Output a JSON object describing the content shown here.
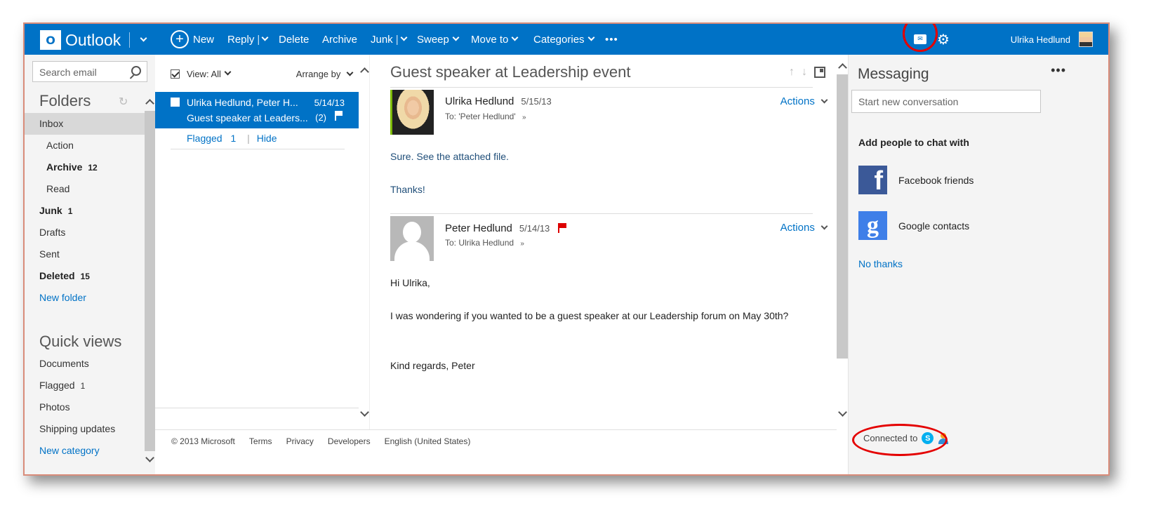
{
  "app": {
    "logo_letter": "O",
    "name": "Outlook"
  },
  "toolbar": {
    "new_label": "New",
    "reply_label": "Reply",
    "delete_label": "Delete",
    "archive_label": "Archive",
    "junk_label": "Junk",
    "sweep_label": "Sweep",
    "moveto_label": "Move to",
    "categories_label": "Categories",
    "more_label": "•••",
    "chat_icon": "chat-icon",
    "settings_icon": "gear-icon",
    "user_name": "Ulrika Hedlund"
  },
  "left": {
    "search_placeholder": "Search email",
    "folders_title": "Folders",
    "folders": [
      {
        "label": "Inbox",
        "count": ""
      },
      {
        "label": "Action",
        "count": ""
      },
      {
        "label": "Archive",
        "count": "12"
      },
      {
        "label": "Read",
        "count": ""
      },
      {
        "label": "Junk",
        "count": "1"
      },
      {
        "label": "Drafts",
        "count": ""
      },
      {
        "label": "Sent",
        "count": ""
      },
      {
        "label": "Deleted",
        "count": "15"
      }
    ],
    "new_folder": "New folder",
    "quick_title": "Quick views",
    "quick": [
      {
        "label": "Documents",
        "count": ""
      },
      {
        "label": "Flagged",
        "count": "1"
      },
      {
        "label": "Photos",
        "count": ""
      },
      {
        "label": "Shipping updates",
        "count": ""
      }
    ],
    "new_category": "New category"
  },
  "list": {
    "view_label": "View: All",
    "arrange_label": "Arrange by",
    "message": {
      "from": "Ulrika Hedlund, Peter H...",
      "date": "5/14/13",
      "subject": "Guest speaker at Leaders...",
      "count": "(2)"
    },
    "filter_flagged": "Flagged",
    "filter_count": "1",
    "filter_sep": "|",
    "filter_hide": "Hide"
  },
  "reading": {
    "subject": "Guest speaker at Leadership event",
    "messages": [
      {
        "sender": "Ulrika Hedlund",
        "date": "5/15/13",
        "to": "To: 'Peter Hedlund'",
        "actions": "Actions",
        "body": [
          "Sure. See the attached file.",
          "Thanks!"
        ]
      },
      {
        "sender": "Peter Hedlund",
        "date": "5/14/13",
        "to": "To: Ulrika Hedlund",
        "actions": "Actions",
        "body": [
          "Hi Ulrika,",
          "I was wondering if you wanted to be a guest speaker at our Leadership forum on May 30th?",
          "Kind regards, Peter"
        ]
      }
    ]
  },
  "footer": {
    "copyright": "© 2013 Microsoft",
    "terms": "Terms",
    "privacy": "Privacy",
    "developers": "Developers",
    "language": "English (United States)"
  },
  "messaging": {
    "title": "Messaging",
    "more": "•••",
    "placeholder": "Start new conversation",
    "add_people": "Add people to chat with",
    "facebook": "Facebook friends",
    "google": "Google contacts",
    "no_thanks": "No thanks",
    "connected": "Connected to",
    "skype_letter": "S"
  },
  "colors": {
    "brand": "#0072c6",
    "selected": "#0072c6",
    "flag": "#d00000",
    "annotation": "#e40000"
  }
}
